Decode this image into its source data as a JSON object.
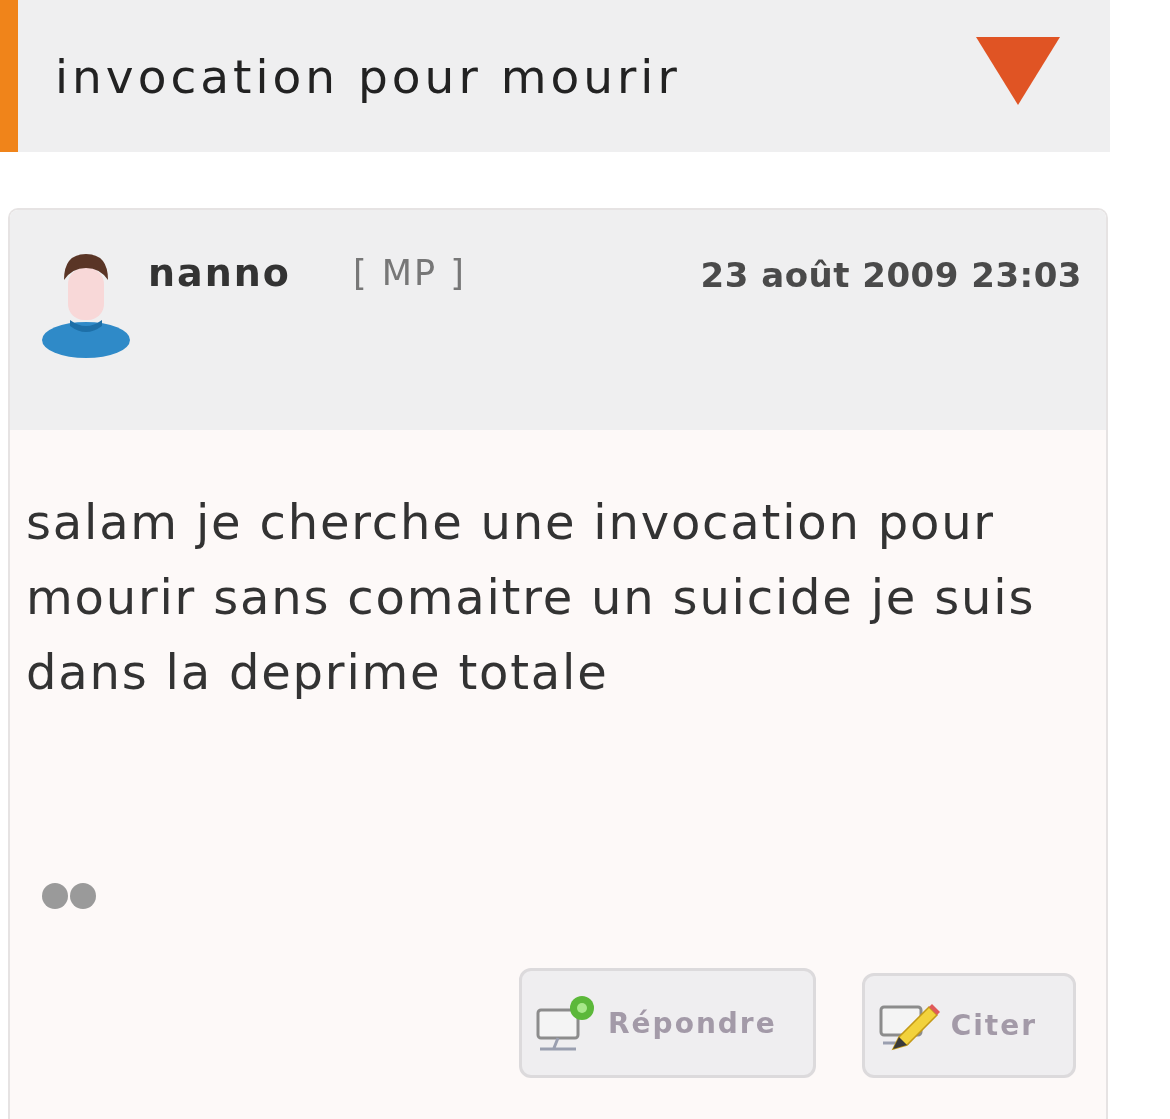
{
  "topic": {
    "title": "invocation pour mourir"
  },
  "post": {
    "author": "nanno",
    "pm_link": "[ MP ]",
    "date": "23 août 2009 23:03",
    "message": "salam je cherche une invocation pour mourir sans comaitre un suicide je suis dans la deprime totale",
    "actions": [
      {
        "kind": "reply",
        "label": "Répondre"
      },
      {
        "kind": "quote",
        "label": "Citer"
      }
    ]
  }
}
